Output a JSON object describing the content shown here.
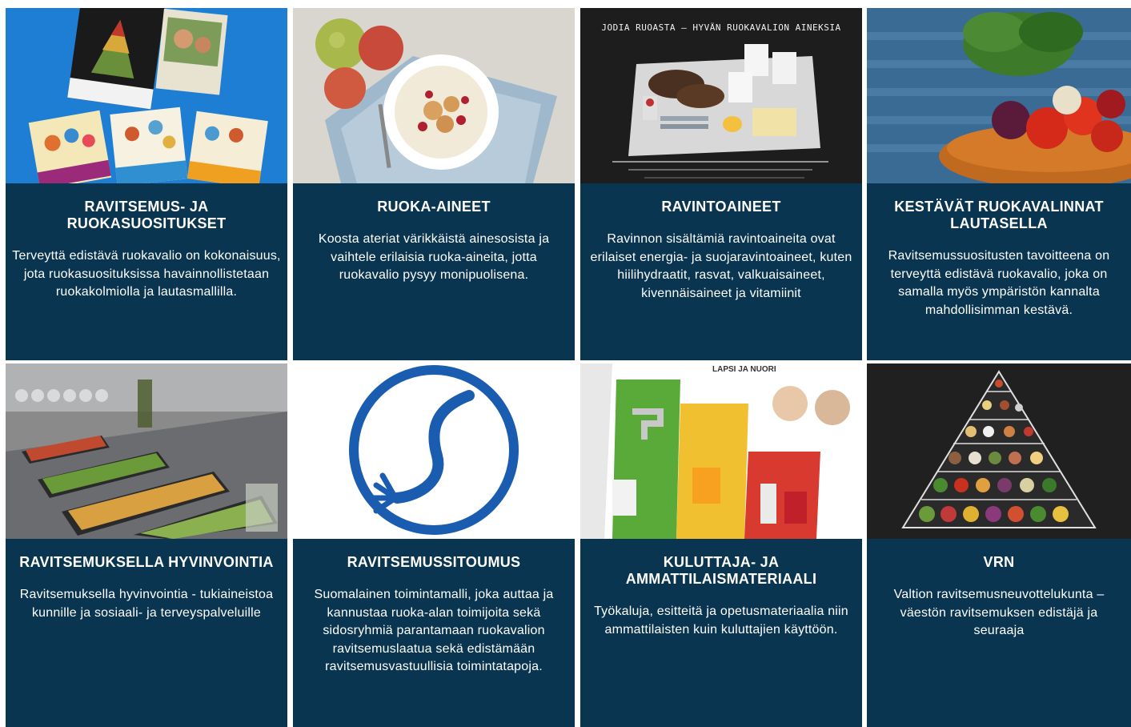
{
  "colors": {
    "card_bg": "#0a3550",
    "card_text": "#ffffff",
    "logo_blue": "#1a5cb0"
  },
  "cards": [
    {
      "title": "Ravitsemus- ja ruokasuositukset",
      "description": "Terveyttä edistävä ruokavalio on kokonaisuus, jota ruokasuosituksissa havainnollistetaan ruokakolmiolla ja lautasmallilla.",
      "image_icon": "publications-covers-image"
    },
    {
      "title": "Ruoka-aineet",
      "description": "Koosta ateriat värikkäistä ainesosista ja vaihtele erilaisia ruoka-aineita, jotta ruokavalio pysyy monipuolisena.",
      "image_icon": "porridge-apples-image"
    },
    {
      "title": "Ravintoaineet",
      "description": "Ravinnon sisältämiä ravintoaineita ovat erilaiset energia- ja suojaravintoaineet, kuten hiilihydraatit, rasvat, valkuaisaineet, kivennäisaineet ja vitamiinit",
      "image_icon": "chalkboard-food-image",
      "image_caption": "JODIA RUOASTA – HYVÄN RUOKAVALION AINEKSIA"
    },
    {
      "title": "Kestävät ruokavalinnat lautasella",
      "description": "Ravitsemussuositusten tavoitteena on terveyttä edistävä ruokavalio, joka on samalla myös ympäristön kannalta mahdollisimman kestävä.",
      "image_icon": "vegetable-bowl-image"
    },
    {
      "title": "Ravitsemuksella hyvinvointia",
      "description": "Ravitsemuksella hyvinvointia - tukiaineistoa kunnille ja sosiaali- ja terveyspalveluille",
      "image_icon": "salad-buffet-image"
    },
    {
      "title": "Ravitsemussitoumus",
      "description": "Suomalainen toimintamalli, joka auttaa ja kannustaa ruoka-alan toimijoita sekä sidosryhmiä parantamaan ruokavalion ravitsemuslaatua sekä edistämään ravitsemusvastuullisia toimintatapoja.",
      "image_icon": "plate-fork-logo"
    },
    {
      "title": "Kuluttaja- ja ammattilaismateriaali",
      "description": "Työkaluja, esitteitä ja opetusmateriaalia niin ammattilaisten kuin kuluttajien käyttöön.",
      "image_icon": "drinks-poster-image",
      "image_caption": "LAPSI JA NUORI"
    },
    {
      "title": "VRN",
      "description": "Valtion ravitsemusneuvottelukunta – väestön ravitsemuksen edistäjä ja seuraaja",
      "image_icon": "food-pyramid-image"
    }
  ]
}
